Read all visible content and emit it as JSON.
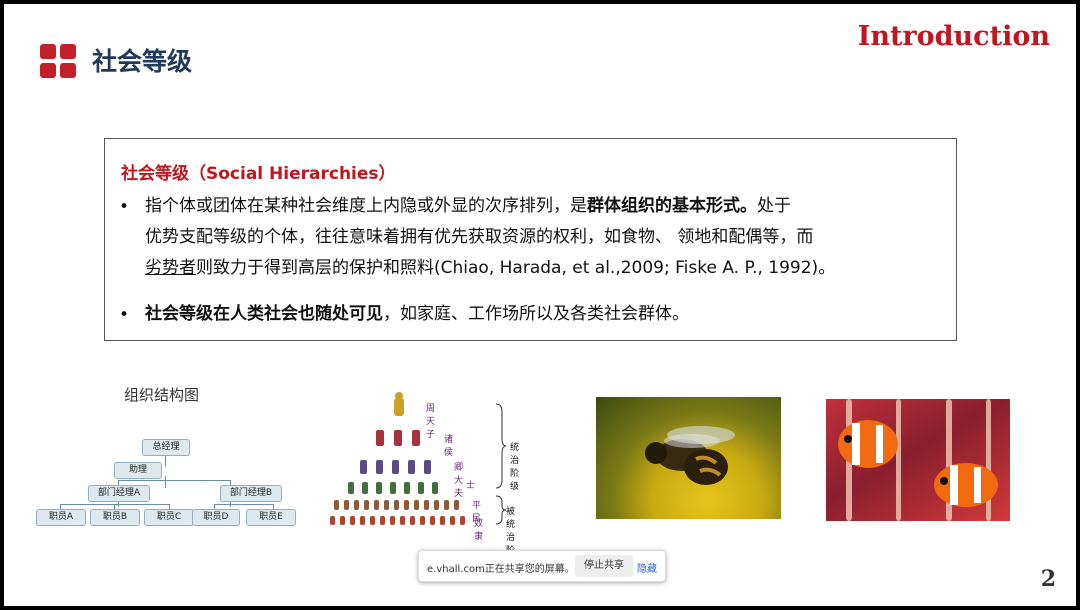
{
  "header": {
    "section_title": "社会等级",
    "intro_label": "Introduction"
  },
  "textbox": {
    "title": "社会等级（Social Hierarchies）",
    "bullet_symbol": "•",
    "para1_line1_a": "指个体或团体在某种社会维度上内隐或外显的次序排列，是",
    "para1_line1_b": "群体组织的基本形式。",
    "para1_line1_c": "处于",
    "para1_line2": "优势支配等级的个体，往往意味着拥有优先获取资源的权利，如食物、 领地和配偶等，而",
    "para1_line3_a": "劣势者",
    "para1_line3_b": "则致力于得到高层的保护和照料(Chiao, Harada, et al.,2009; Fiske A. P., 1992)。",
    "para2_a": "社会等级在人类社会也随处可见",
    "para2_b": "，如家庭、工作场所以及各类社会群体。"
  },
  "org_chart": {
    "title": "组织结构图",
    "ceo": "总经理",
    "assistant": "助理",
    "dept_a": "部门经理A",
    "dept_b": "部门经理B",
    "staff": [
      "职员A",
      "职员B",
      "职员C",
      "职员D",
      "职员E"
    ]
  },
  "pyramid": {
    "levels": [
      "周天子",
      "诸侯",
      "卿大夫",
      "士",
      "平民",
      "奴隶"
    ],
    "ruling": "统治阶级",
    "ruled": "被统治阶级"
  },
  "share_bar": {
    "text": "e.vhall.com正在共享您的屏幕。",
    "stop_label": "停止共享",
    "hide_label": "隐藏"
  },
  "page_number": "2",
  "colors": {
    "accent_red": "#c0161f",
    "title_navy": "#1f3a5a",
    "logo_red": "#c3202b"
  }
}
